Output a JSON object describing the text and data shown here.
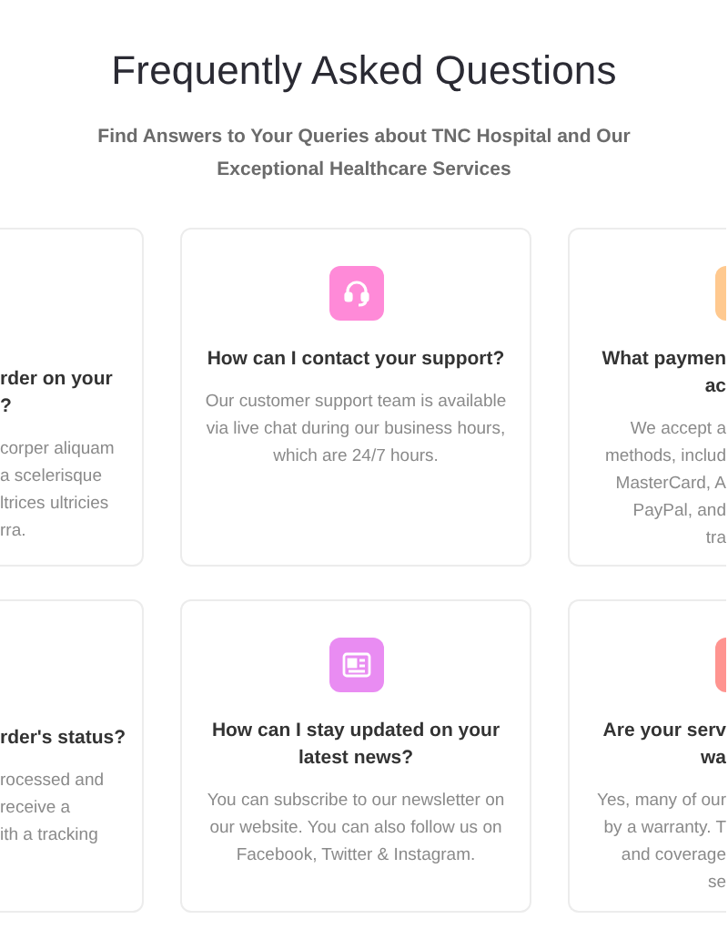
{
  "heading": {
    "title": "Frequently Asked Questions",
    "subtitle": "Find Answers to Your Queries about TNC Hospital and Our Exceptional Healthcare Services"
  },
  "rows": [
    {
      "cards": [
        {
          "kind": "clipped-left",
          "title_lines": [
            "rder on your",
            "?"
          ],
          "body_lines": [
            "corper aliquam",
            "a scelerisque",
            "ltrices ultricies",
            "rra."
          ]
        },
        {
          "kind": "full",
          "color": "#ff8ad8",
          "title": "How can I contact your support?",
          "body": "Our customer support team is available via live chat during our business hours, which are 24/7 hours."
        },
        {
          "kind": "clipped-right",
          "color": "#ffc98f",
          "title_lines": [
            "What paymen",
            "ac"
          ],
          "body_lines": [
            "We accept a",
            "methods, includ",
            "MasterCard, A",
            "PayPal, and",
            "tra"
          ]
        }
      ]
    },
    {
      "cards": [
        {
          "kind": "clipped-left",
          "title_lines": [
            "rder's status?"
          ],
          "body_lines": [
            "rocessed and",
            "receive a",
            "ith a tracking"
          ]
        },
        {
          "kind": "full",
          "color": "#e98cf2",
          "title": "How can I stay updated on your latest news?",
          "body": "You can subscribe to our newsletter on our website. You can also follow us on Facebook, Twitter & Instagram."
        },
        {
          "kind": "clipped-right",
          "color": "#ff9490",
          "title_lines": [
            "Are your serv",
            "wa"
          ],
          "body_lines": [
            "Yes, many of our",
            "by a warranty. T",
            "and coverage",
            "se"
          ]
        }
      ]
    }
  ]
}
